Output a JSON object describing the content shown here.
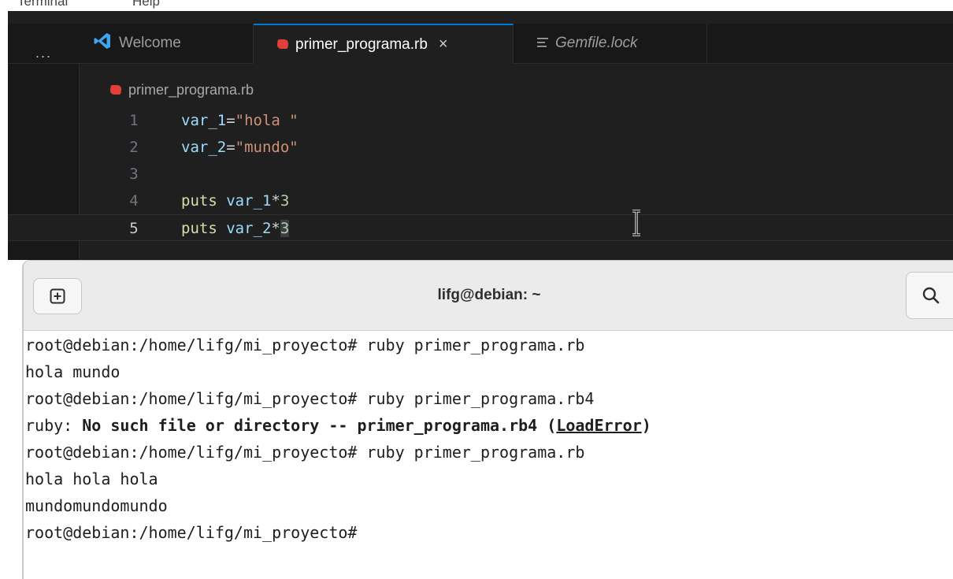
{
  "menubar": {
    "items": [
      "Terminal",
      "Help"
    ]
  },
  "editor": {
    "more_label": "···",
    "tabs": [
      {
        "label": "Welcome",
        "icon": "vscode-logo-icon",
        "active": false
      },
      {
        "label": "primer_programa.rb",
        "icon": "ruby-file-icon",
        "active": true,
        "close": "×"
      },
      {
        "label": "Gemfile.lock",
        "icon": "lines-file-icon",
        "active": false,
        "italic": true
      }
    ],
    "breadcrumb": "primer_programa.rb",
    "lines": [
      {
        "num": "1",
        "tokens": [
          {
            "t": "var_1",
            "c": "var"
          },
          {
            "t": "=",
            "c": "plain"
          },
          {
            "t": "\"hola \"",
            "c": "str"
          }
        ]
      },
      {
        "num": "2",
        "tokens": [
          {
            "t": "var_2",
            "c": "var"
          },
          {
            "t": "=",
            "c": "plain"
          },
          {
            "t": "\"mundo\"",
            "c": "str"
          }
        ]
      },
      {
        "num": "3",
        "tokens": []
      },
      {
        "num": "4",
        "tokens": [
          {
            "t": "puts",
            "c": "kw"
          },
          {
            "t": " ",
            "c": "plain"
          },
          {
            "t": "var_1",
            "c": "var"
          },
          {
            "t": "*",
            "c": "plain"
          },
          {
            "t": "3",
            "c": "num"
          }
        ]
      },
      {
        "num": "5",
        "tokens": [
          {
            "t": "puts",
            "c": "kw"
          },
          {
            "t": " ",
            "c": "plain"
          },
          {
            "t": "var_2",
            "c": "var"
          },
          {
            "t": "*",
            "c": "plain"
          },
          {
            "t": "3",
            "c": "num-sel"
          }
        ]
      }
    ],
    "current_line": "5",
    "colors": {
      "accent": "#0078d4",
      "background": "#1f1f1f",
      "string": "#ce9178",
      "keyword": "#dcdcaa",
      "variable": "#9cdcfe",
      "number": "#b5cea8"
    }
  },
  "terminal": {
    "title": "lifg@debian: ~",
    "new_tab_icon": "plus-box-icon",
    "search_icon": "search-icon",
    "lines": [
      [
        {
          "t": "root@debian:/home/lifg/mi_proyecto# ruby primer_programa.rb"
        }
      ],
      [
        {
          "t": "hola mundo"
        }
      ],
      [
        {
          "t": "root@debian:/home/lifg/mi_proyecto# ruby primer_programa.rb4"
        }
      ],
      [
        {
          "t": "ruby: "
        },
        {
          "t": "No such file or directory -- primer_programa.rb4 (",
          "s": "bold"
        },
        {
          "t": "LoadError",
          "s": "bold-underline"
        },
        {
          "t": ")",
          "s": "bold"
        }
      ],
      [
        {
          "t": "root@debian:/home/lifg/mi_proyecto# ruby primer_programa.rb"
        }
      ],
      [
        {
          "t": "hola hola hola"
        }
      ],
      [
        {
          "t": "mundomundomundo"
        }
      ],
      [
        {
          "t": "root@debian:/home/lifg/mi_proyecto# "
        }
      ]
    ]
  }
}
